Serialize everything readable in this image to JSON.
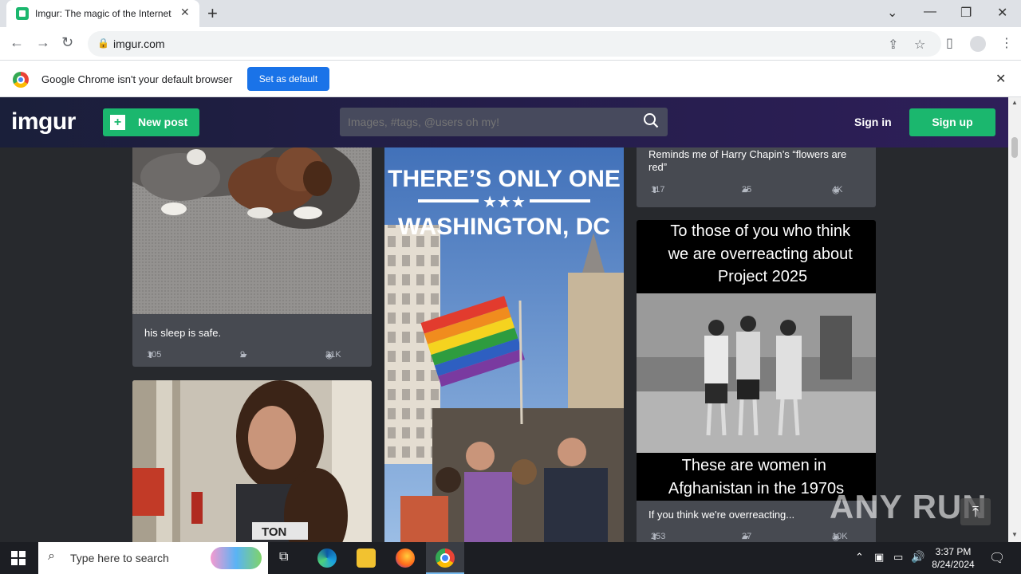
{
  "browser": {
    "tab_title": "Imgur: The magic of the Internet",
    "url": "imgur.com",
    "infobar_message": "Google Chrome isn't your default browser",
    "set_default_label": "Set as default"
  },
  "imgur": {
    "logo": "imgur",
    "new_post_label": "New post",
    "search_placeholder": "Images, #tags, @users oh my!",
    "sign_in_label": "Sign in",
    "sign_up_label": "Sign up"
  },
  "posts": [
    {
      "caption": "his sleep is safe.",
      "upvotes": "105",
      "comments": "9",
      "views": "21K"
    },
    {
      "caption": "Reminds me of Harry Chapin’s “flowers are red”",
      "upvotes": "117",
      "comments": "35",
      "views": "4K"
    },
    {
      "caption": "If you think we're overreacting...",
      "upvotes": "253",
      "comments": "37",
      "views": "10K"
    }
  ],
  "images": {
    "washington_line1": "THERE’S ONLY ONE",
    "washington_stars": "★★★",
    "washington_line2": "WASHINGTON, DC",
    "afghan_top": "To those of you who think we are overreacting about Project 2025",
    "afghan_bottom": "These are women in Afghanistan in the 1970s",
    "shirt_text": "TON"
  },
  "taskbar": {
    "search_placeholder": "Type here to search",
    "time": "3:37 PM",
    "date": "8/24/2024"
  },
  "watermark": "ANY RUN",
  "colors": {
    "imgur_green": "#1bb76e",
    "page_bg": "#27292d",
    "card_bg": "#474a51",
    "chrome_blue": "#1a73e8"
  }
}
